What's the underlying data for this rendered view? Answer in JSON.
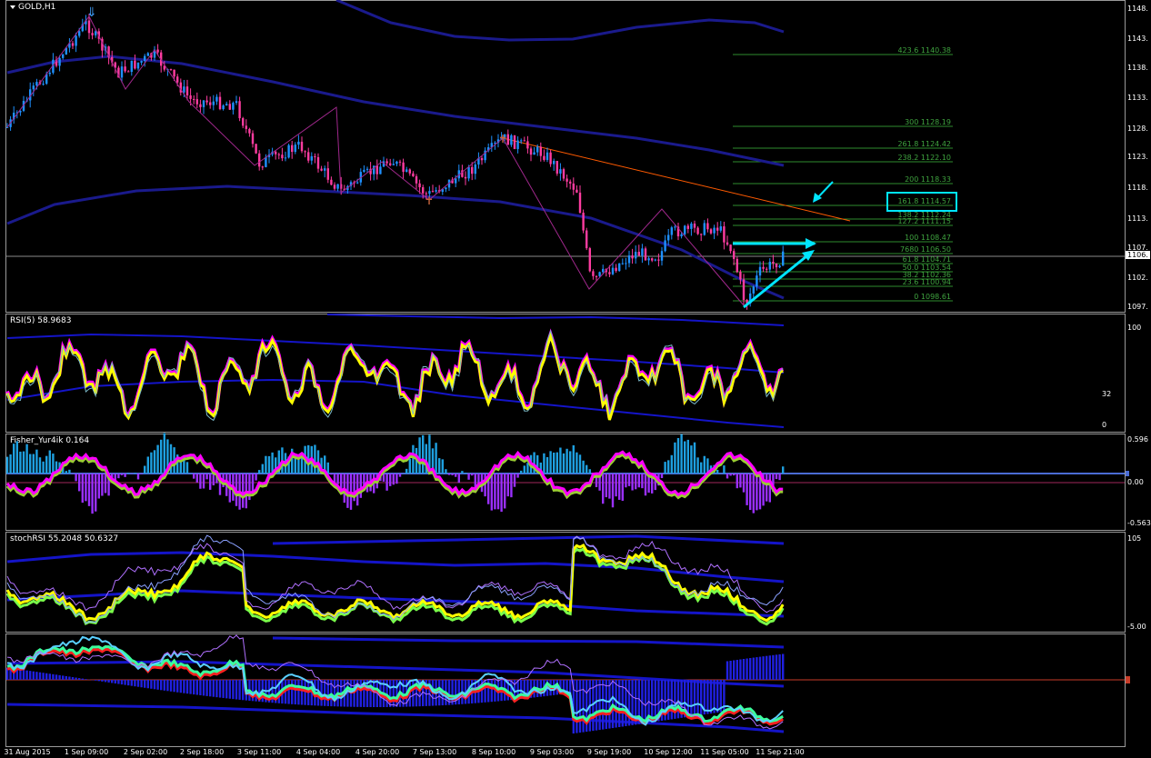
{
  "chart_title": "GOLD,H1",
  "main": {
    "price_ticks": [
      "1148.",
      "1143.",
      "1138.",
      "1133.",
      "1128.",
      "1123.",
      "1118.",
      "1113.",
      "1107.",
      "1102.",
      "1097."
    ],
    "current_price": "1106.",
    "fib_levels": [
      "423.6  1140.38",
      "300  1128.19",
      "261.8  1124.42",
      "238.2  1122.10",
      "200  1118.33",
      "161.8  1114.57",
      "138.2  1112.24",
      "127.2  1111.15",
      "100  1108.47",
      "7680  1106.50",
      "61.8  1104.71",
      "50.0  1103.54",
      "38.2  1102.36",
      "23.6  1100.94",
      "0  1098.61"
    ]
  },
  "rsi": {
    "label": "RSI(5) 58.9683",
    "ticks": [
      "100",
      "32",
      "0"
    ]
  },
  "fisher": {
    "label": "Fisher_Yur4ik 0.164",
    "ticks": [
      "0.596",
      "0.00",
      "-0.563"
    ]
  },
  "stoch": {
    "label": "stochRSI 55.2048 50.6327",
    "ticks": [
      "105",
      "-5.00"
    ]
  },
  "macd": {
    "ticks": []
  },
  "time_labels": [
    "31 Aug 2015",
    "1 Sep 09:00",
    "2 Sep 02:00",
    "2 Sep 18:00",
    "3 Sep 11:00",
    "4 Sep 04:00",
    "4 Sep 20:00",
    "7 Sep 13:00",
    "8 Sep 10:00",
    "9 Sep 03:00",
    "9 Sep 19:00",
    "10 Sep 12:00",
    "11 Sep 05:00",
    "11 Sep 21:00"
  ],
  "colors": {
    "bull": "#1e90ff",
    "bear": "#ff3ca0",
    "band": "#1a1a8c",
    "trend": "#ff5a00",
    "fib": "#2e8b2e",
    "arrow": "#00e5ff",
    "rsi_main": "#ffff00",
    "rsi_mag": "#ff00ff",
    "hist_up": "#1ea0e0",
    "hist_dn": "#9b30ff",
    "green": "#9acd32"
  }
}
